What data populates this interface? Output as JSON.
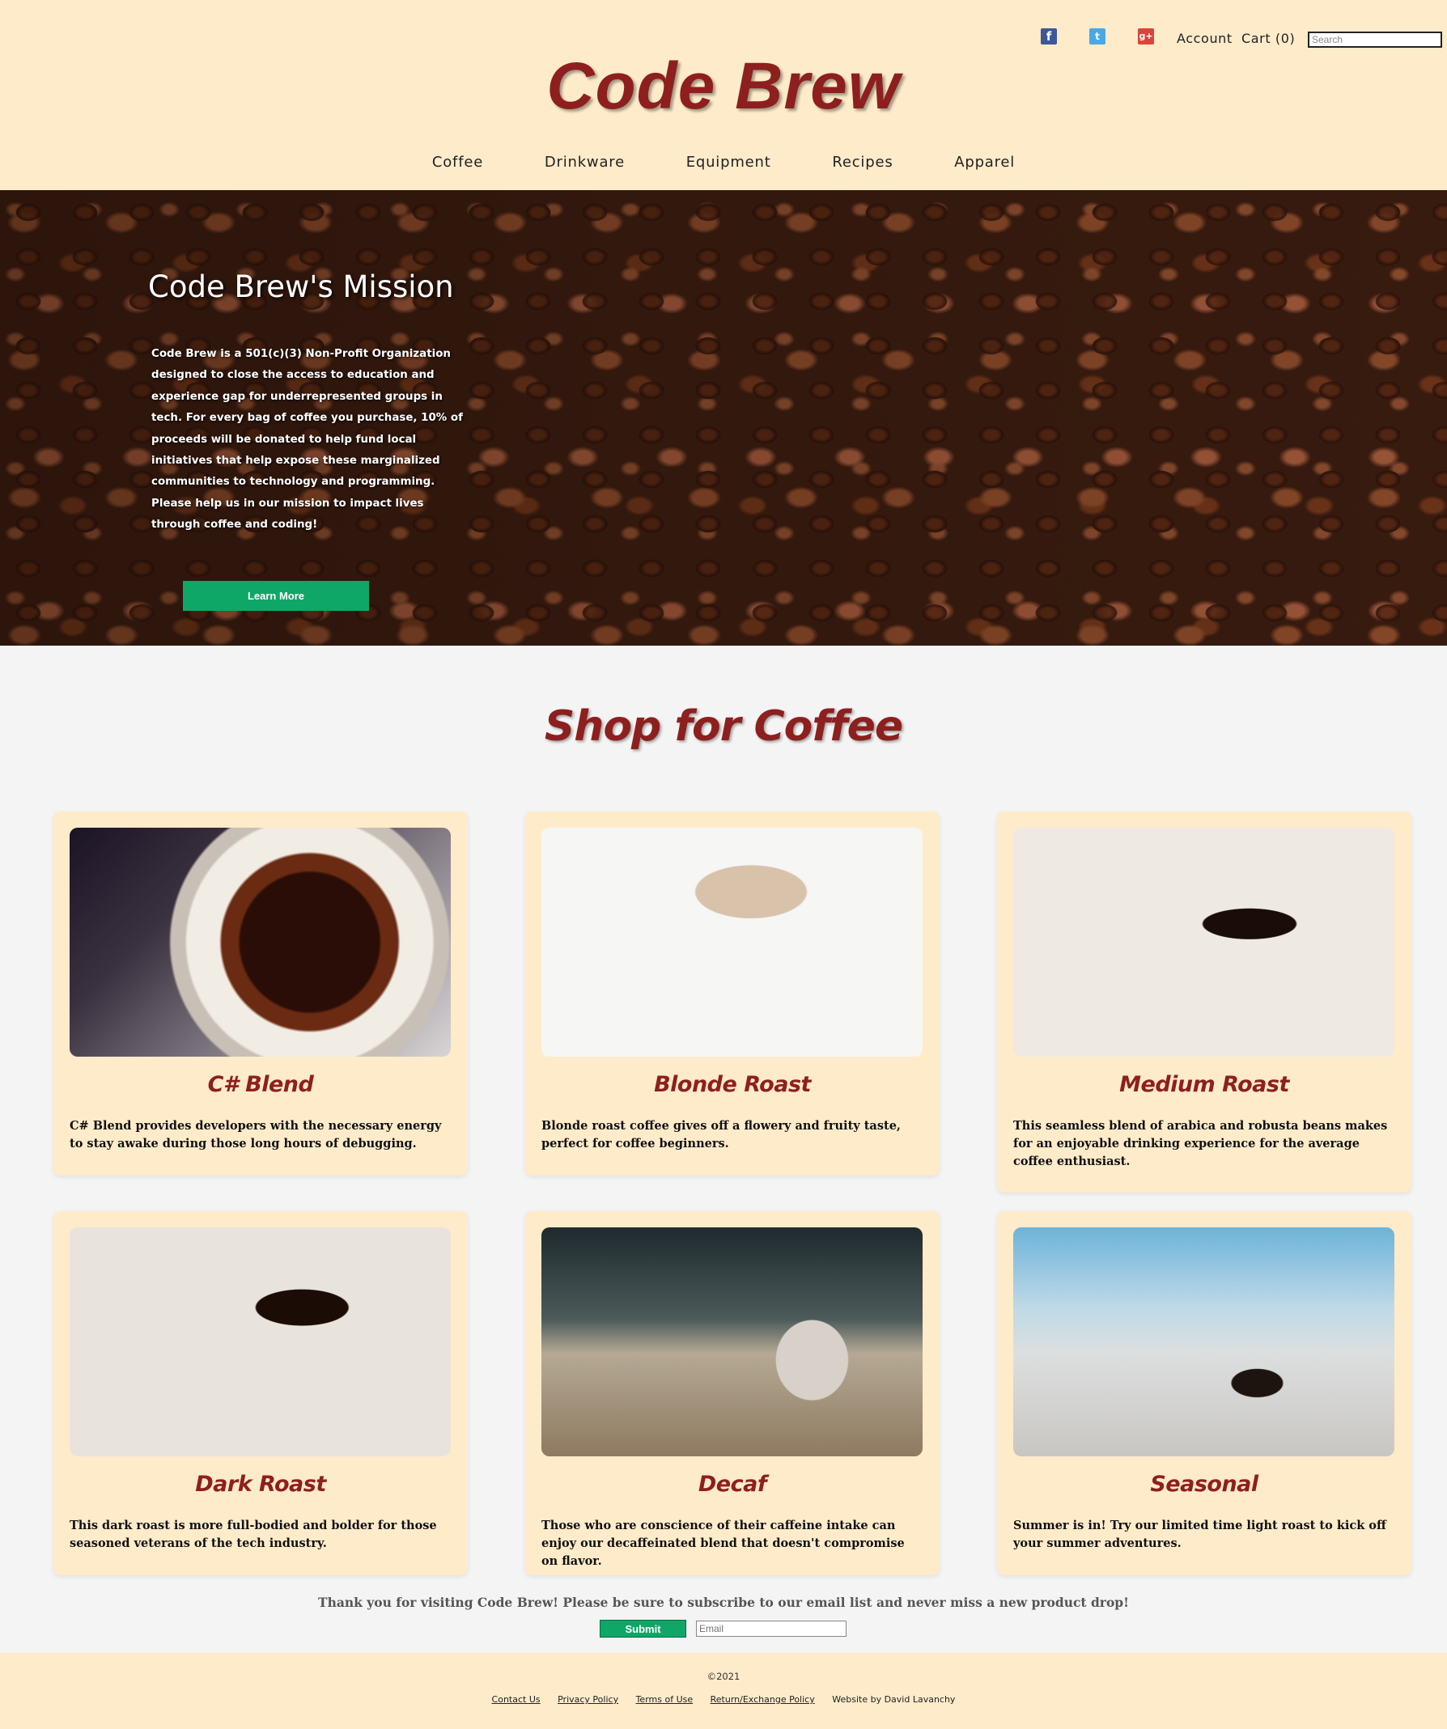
{
  "header": {
    "social": [
      "facebook-icon",
      "twitter-icon",
      "google-plus-icon"
    ],
    "social_glyphs": {
      "facebook": "f",
      "twitter": "t",
      "google": "g+"
    },
    "account_label": "Account",
    "cart_label": "Cart (0)",
    "search_placeholder": "Search",
    "logo": "Code Brew",
    "nav": [
      "Coffee",
      "Drinkware",
      "Equipment",
      "Recipes",
      "Apparel"
    ]
  },
  "hero": {
    "title": "Code Brew's Mission",
    "text": "Code Brew is a 501(c)(3) Non-Profit Organization designed to close the access to education and experience gap for underrepresented groups in tech. For every bag of coffee you purchase, 10% of proceeds will be donated to help fund local initiatives that help expose these marginalized communities to technology and programming. Please help us in our mission to impact lives through coffee and coding!",
    "button_label": "Learn More"
  },
  "shop": {
    "title": "Shop for Coffee",
    "products": [
      {
        "name": "C# Blend",
        "description": "C# Blend provides developers with the necessary energy to stay awake during those long hours of debugging."
      },
      {
        "name": "Blonde Roast",
        "description": "Blonde roast coffee gives off a flowery and fruity taste, perfect for coffee beginners."
      },
      {
        "name": "Medium Roast",
        "description": "This seamless blend of arabica and robusta beans makes for an enjoyable drinking experience for the average coffee enthusiast."
      },
      {
        "name": "Dark Roast",
        "description": "This dark roast is more full-bodied and bolder for those seasoned veterans of the tech industry."
      },
      {
        "name": "Decaf",
        "description": "Those who are conscience of their caffeine intake can enjoy our decaffeinated blend that doesn't compromise on flavor."
      },
      {
        "name": "Seasonal",
        "description": "Summer is in! Try our limited time light roast to kick off your summer adventures."
      }
    ]
  },
  "subscribe": {
    "thanks": "Thank you for visiting Code Brew! Please be sure to subscribe to our email list and never miss a new product drop!",
    "submit_label": "Submit",
    "email_placeholder": "Email"
  },
  "footer": {
    "copyright": "©2021",
    "links": [
      "Contact Us",
      "Privacy Policy",
      "Terms of Use",
      "Return/Exchange Policy"
    ],
    "credit": "Website by David Lavanchy"
  },
  "colors": {
    "header_bg": "#feebca",
    "brand_red": "#8e1f1f",
    "button_green": "#0ea768",
    "page_bg": "#f4f4f4"
  }
}
